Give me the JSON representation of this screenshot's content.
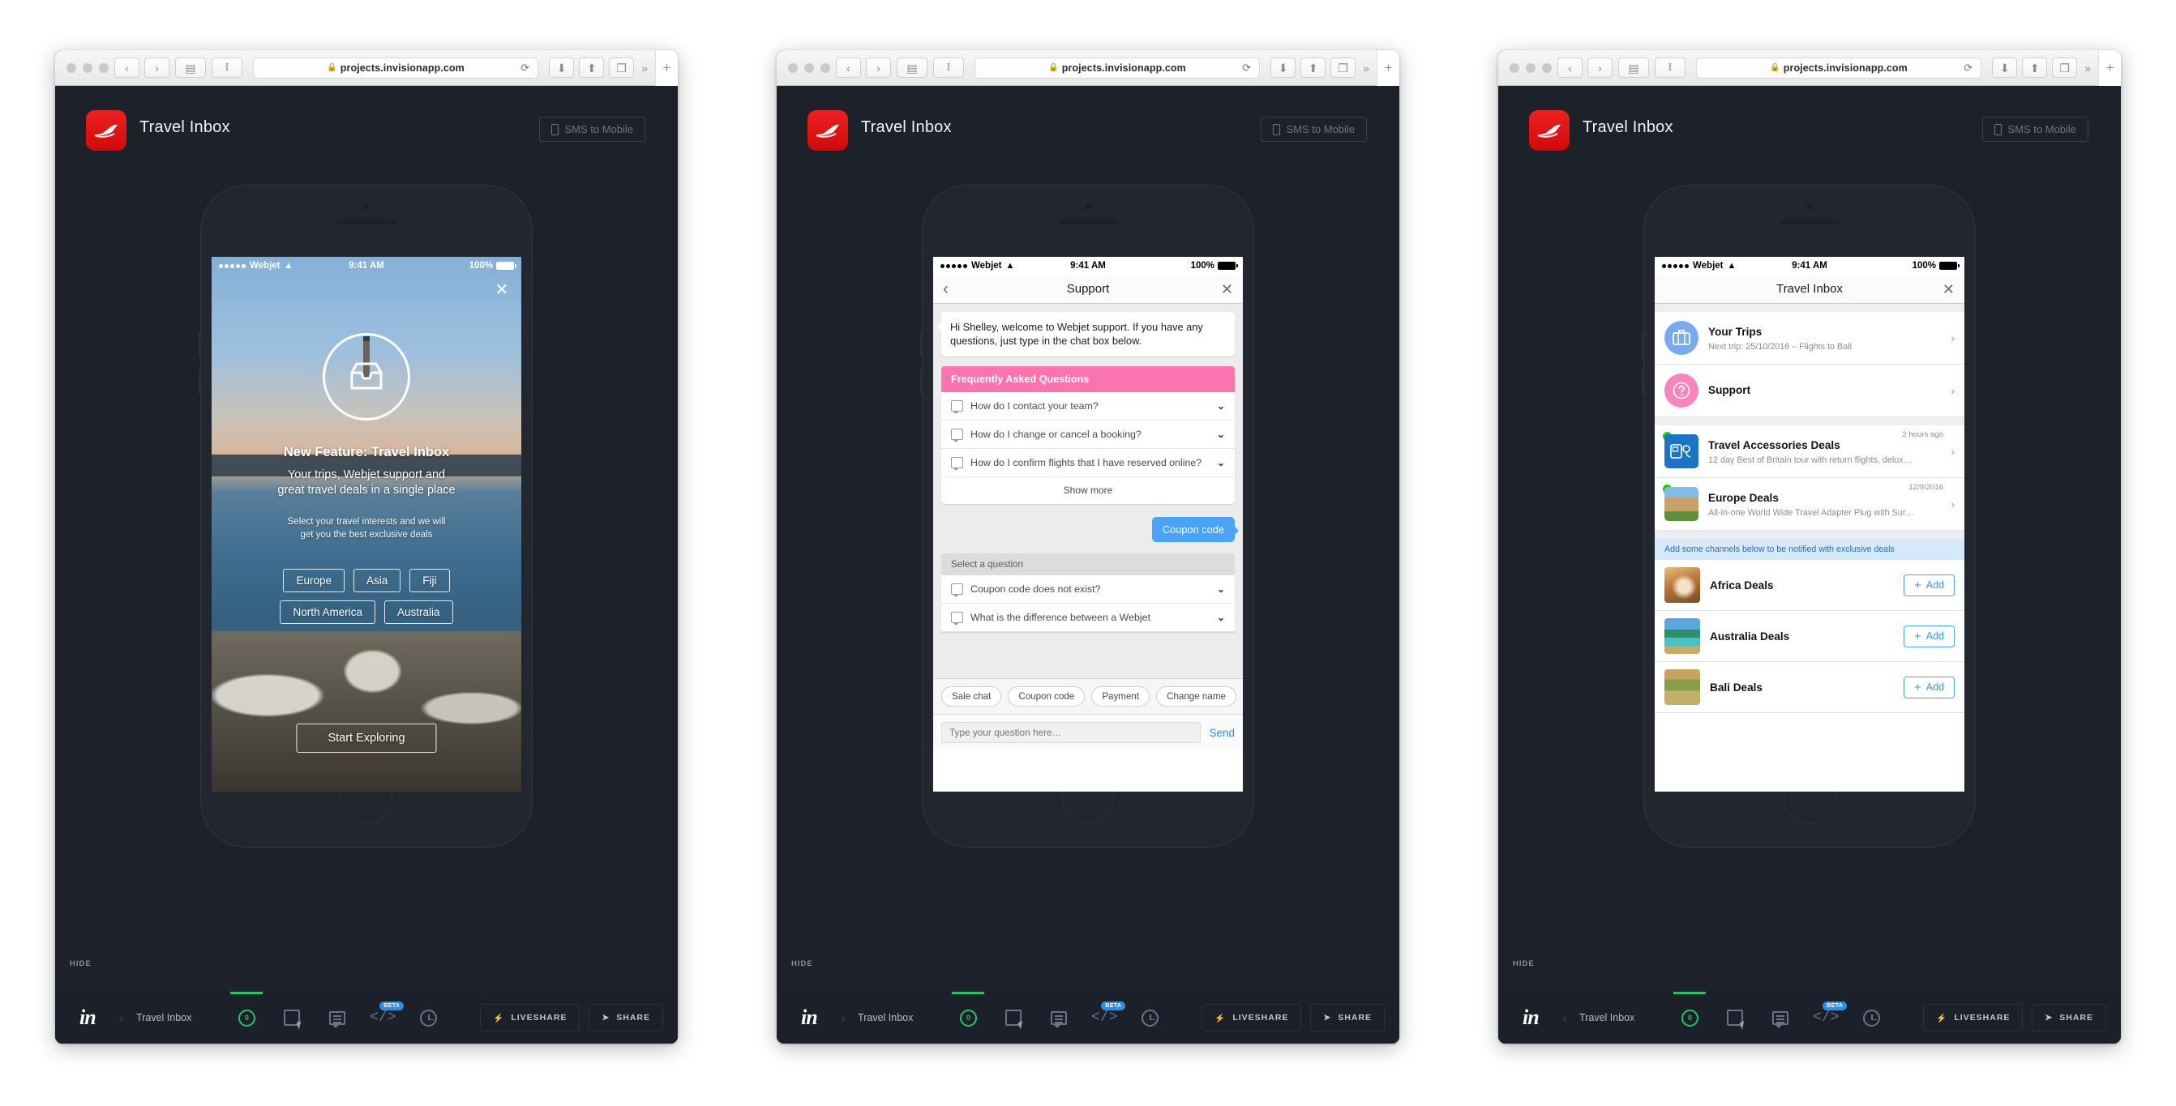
{
  "browser": {
    "url": "projects.invisionapp.com",
    "lock_icon": "lock-icon",
    "reload_icon": "reload-icon",
    "back_icon": "back-chevron-icon",
    "forward_icon": "forward-chevron-icon",
    "sidebar_icon": "sidebar-toggle-icon",
    "reader_icon": "reader-view-icon",
    "downloads_icon": "downloads-icon",
    "share_icon": "share-icon",
    "tabs_icon": "tab-overview-icon",
    "overflow_icon": "more-chevrons-icon",
    "newtab_icon": "new-tab-plus-icon"
  },
  "project": {
    "title": "Travel Inbox",
    "logo_icon": "webjet-plane-logo",
    "sms_button": "SMS to Mobile",
    "sms_icon": "mobile-phone-icon"
  },
  "status_bar": {
    "carrier": "Webjet",
    "wifi_icon": "wifi-icon",
    "time": "9:41 AM",
    "battery": "100%"
  },
  "screen1": {
    "close_icon": "close-x-icon",
    "hero_icon": "inbox-tray-icon",
    "headline": "New Feature: Travel Inbox",
    "subline_1": "Your trips, Webjet support and",
    "subline_2": "great travel deals in a single place",
    "note_1": "Select your travel interests and we will",
    "note_2": "get you the best exclusive deals",
    "tags_row1": [
      "Europe",
      "Asia",
      "Fiji"
    ],
    "tags_row2": [
      "North America",
      "Australia"
    ],
    "cta": "Start Exploring"
  },
  "screen2": {
    "nav_title": "Support",
    "back_icon": "back-chevron-icon",
    "close_icon": "close-x-icon",
    "welcome_message": "Hi Shelley, welcome to Webjet support. If you have any questions, just type in the chat box below.",
    "faq_header": "Frequently Asked Questions",
    "faq_items": [
      "How do I contact your team?",
      "How do I change or cancel a booking?",
      "How do I confirm flights that I have reserved online?"
    ],
    "show_more": "Show more",
    "user_message": "Coupon code",
    "select_header": "Select a question",
    "select_items": [
      "Coupon code does not exist?",
      "What is the difference between a Webjet"
    ],
    "chips": [
      "Sale chat",
      "Coupon code",
      "Payment",
      "Change name"
    ],
    "composer_placeholder": "Type your question here…",
    "send_label": "Send"
  },
  "screen3": {
    "nav_title": "Travel Inbox",
    "close_icon": "close-x-icon",
    "rows": [
      {
        "title": "Your Trips",
        "subtitle": "Next trip: 25/10/2016 – Flights to Bali",
        "icon": "suitcase-icon",
        "avatar": "blue",
        "time": "",
        "unread": false
      },
      {
        "title": "Support",
        "subtitle": "",
        "icon": "question-mark-icon",
        "avatar": "pink",
        "time": "",
        "unread": false
      },
      {
        "title": "Travel Accessories Deals",
        "subtitle": "12 day Best of Britain tour with return flights, delux…",
        "icon": "travel-adapter-icon",
        "avatar": "thumb-accessories",
        "time": "2 hours ago",
        "unread": true
      },
      {
        "title": "Europe Deals",
        "subtitle": "All-in-one World Wide Travel Adapter Plug with Sur…",
        "icon": "europe-thumb",
        "avatar": "thumb-europe",
        "time": "12/9/2016",
        "unread": true
      }
    ],
    "banner": "Add some channels below to be notified with exclusive deals",
    "channels": [
      {
        "name": "Africa Deals",
        "thumb": "th-lion",
        "add_label": "Add"
      },
      {
        "name": "Australia Deals",
        "thumb": "th-aus",
        "add_label": "Add"
      },
      {
        "name": "Bali Deals",
        "thumb": "th-bali",
        "add_label": "Add"
      }
    ],
    "add_icon": "plus-icon"
  },
  "invision": {
    "hide_label": "HIDE",
    "logo": "in",
    "breadcrumb_separator": "›",
    "breadcrumb": "Travel Inbox",
    "tools": [
      {
        "name": "preview-tool",
        "icon": "eye-ring-icon",
        "badge": "",
        "label": "0"
      },
      {
        "name": "build-tool",
        "icon": "hotspot-cursor-icon",
        "badge": ""
      },
      {
        "name": "comment-tool",
        "icon": "comment-icon",
        "badge": ""
      },
      {
        "name": "inspect-tool",
        "icon": "code-brackets-icon",
        "badge": "BETA"
      },
      {
        "name": "history-tool",
        "icon": "clock-icon",
        "badge": ""
      }
    ],
    "liveshare": "LIVESHARE",
    "liveshare_icon": "bolt-icon",
    "share": "SHARE",
    "share_icon": "share-arrow-icon"
  },
  "colors": {
    "brand_red": "#e61e1e",
    "accent_green": "#29c268",
    "accent_blue": "#4aa3f5",
    "accent_pink": "#fb74ae",
    "dark_bg": "#1d2129"
  }
}
